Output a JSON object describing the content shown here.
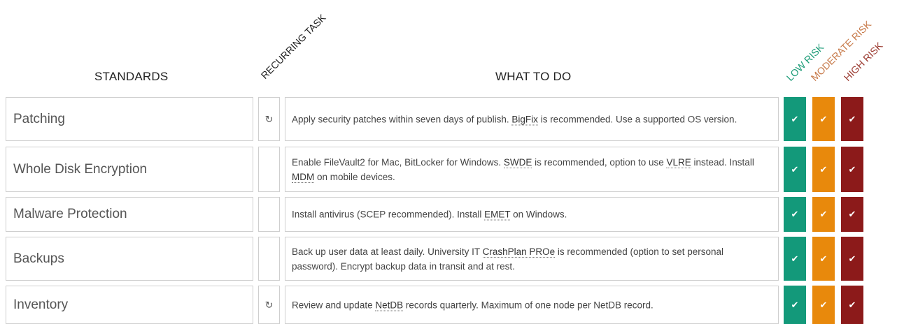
{
  "headers": {
    "standards": "STANDARDS",
    "recurring": "RECURRING TASK",
    "what": "WHAT TO DO",
    "low": "LOW RISK",
    "moderate": "MODERATE RISK",
    "high": "HIGH RISK"
  },
  "icons": {
    "recurring": "refresh-icon",
    "check": "checkmark-icon"
  },
  "colors": {
    "low": "#13997a",
    "moderate": "#e8890c",
    "high": "#8c1a1a"
  },
  "rows": [
    {
      "name": "Patching",
      "recurring": true,
      "what": [
        {
          "t": "Apply security patches within seven days of publish. "
        },
        {
          "t": "BigFix",
          "link": true
        },
        {
          "t": " is recommended. Use a supported OS version."
        }
      ]
    },
    {
      "name": "Whole Disk Encryption",
      "recurring": false,
      "what": [
        {
          "t": "Enable FileVault2 for Mac, BitLocker for Windows. "
        },
        {
          "t": "SWDE",
          "link": true
        },
        {
          "t": " is recommended, option to use "
        },
        {
          "t": "VLRE",
          "link": true
        },
        {
          "t": " instead. Install "
        },
        {
          "t": "MDM",
          "link": true
        },
        {
          "t": " on mobile devices."
        }
      ]
    },
    {
      "name": "Malware Protection",
      "recurring": false,
      "what": [
        {
          "t": "Install antivirus (SCEP recommended). Install "
        },
        {
          "t": "EMET",
          "link": true
        },
        {
          "t": " on Windows."
        }
      ]
    },
    {
      "name": "Backups",
      "recurring": false,
      "what": [
        {
          "t": "Back up user data at least daily. University IT "
        },
        {
          "t": "CrashPlan PROe",
          "link": true
        },
        {
          "t": " is recommended (option to set personal password). Encrypt backup data in transit and at rest."
        }
      ]
    },
    {
      "name": "Inventory",
      "recurring": true,
      "what": [
        {
          "t": "Review and update "
        },
        {
          "t": "NetDB",
          "link": true
        },
        {
          "t": " records quarterly. Maximum of one node per NetDB record."
        }
      ]
    }
  ]
}
